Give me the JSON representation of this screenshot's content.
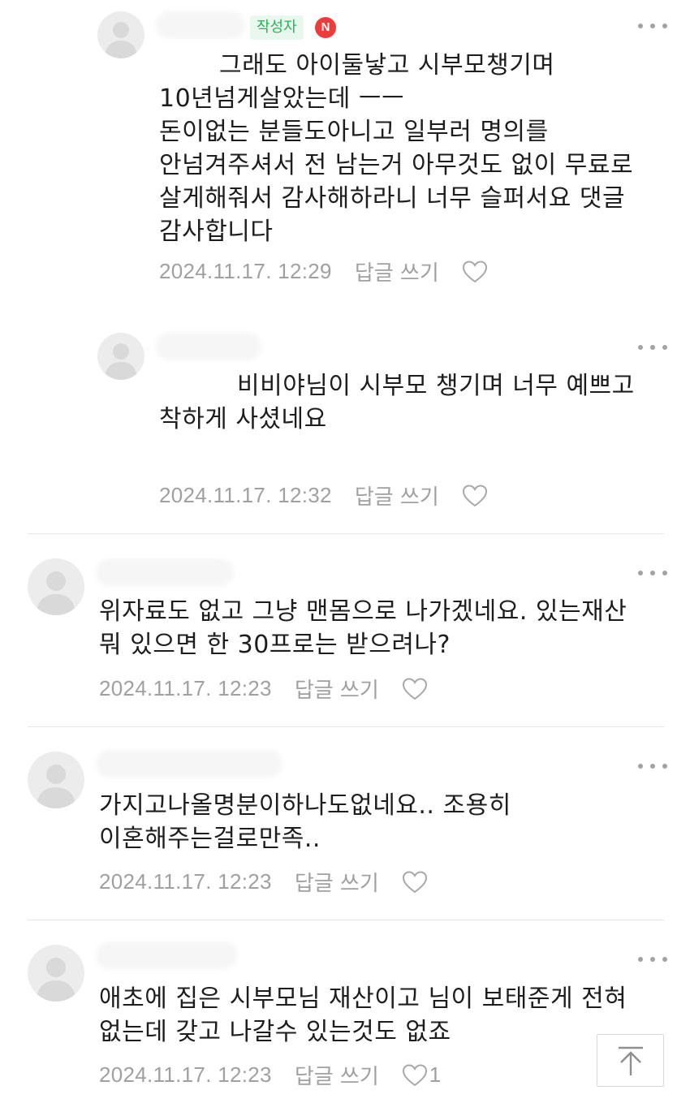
{
  "comments": [
    {
      "text": "그래도 아이둘낳고 시부모챙기며\n10년넘게살았는데 ㅡㅡ\n돈이없는 분들도아니고 일부러 명의를\n안넘겨주셔서 전 남는거 아무것도 없이 무료로\n살게해줘서 감사해하라니 너무 슬퍼서요 댓글\n감사합니다",
      "date": "2024.11.17. 12:29",
      "reply": "답글 쓰기",
      "author_badge": "작성자",
      "new_badge": "N"
    },
    {
      "text": "비비야님이 시부모 챙기며 너무 예쁘고\n착하게 사셨네요",
      "date": "2024.11.17. 12:32",
      "reply": "답글 쓰기"
    },
    {
      "text": "위자료도 없고 그냥 맨몸으로 나가겠네요. 있는재산\n뭐 있으면 한 30프로는 받으려나?",
      "date": "2024.11.17. 12:23",
      "reply": "답글 쓰기"
    },
    {
      "text": "가지고나올명분이하나도없네요.. 조용히\n이혼해주는걸로만족..",
      "date": "2024.11.17. 12:23",
      "reply": "답글 쓰기"
    },
    {
      "text": "애초에 집은 시부모님 재산이고 님이 보태준게 전혀\n없는데 갖고 나갈수 있는것도 없죠",
      "date": "2024.11.17. 12:23",
      "reply": "답글 쓰기",
      "like_count": "1"
    }
  ],
  "icons": {
    "avatar": "default-avatar-icon",
    "more": "more-options-icon",
    "like": "heart-outline-icon",
    "scroll_top": "arrow-up-to-top-icon"
  },
  "colors": {
    "author_badge_bg": "#e9f8ee",
    "author_badge_text": "#27b35a",
    "new_badge": "#ee3b3b",
    "meta_text": "#a0a0a0"
  }
}
